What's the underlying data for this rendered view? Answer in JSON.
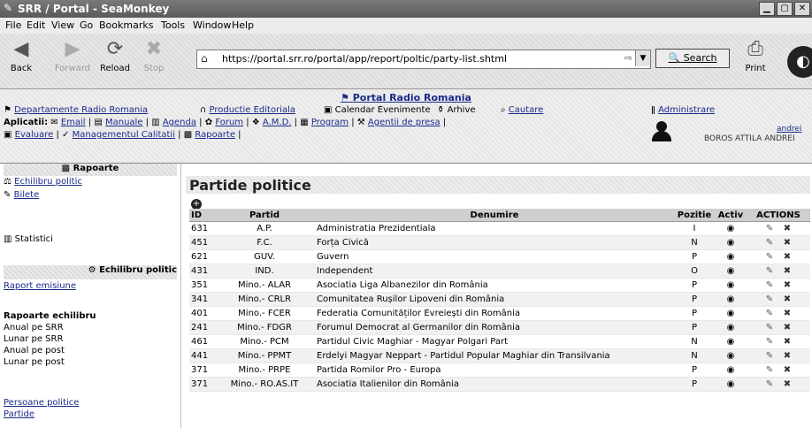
{
  "window": {
    "title": "SRR / Portal - SeaMonkey"
  },
  "menu": [
    "File",
    "Edit",
    "View",
    "Go",
    "Bookmarks",
    "Tools",
    "Window",
    "Help"
  ],
  "toolbar": {
    "back": "Back",
    "forward": "Forward",
    "reload": "Reload",
    "stop": "Stop",
    "url": "https://portal.srr.ro/portal/app/report/poltic/party-list.shtml",
    "search": "Search",
    "print": "Print"
  },
  "header": {
    "portal_title": "Portal Radio Romania",
    "nav1": [
      "Departamente Radio Romania",
      "Productie Editoriala",
      "Calendar Evenimente",
      "Arhive",
      "Cautare"
    ],
    "aplicatii_label": "Aplicatii:",
    "nav2": [
      "Email",
      "Manuale",
      "Agenda",
      "Forum",
      "A.M.D.",
      "Program",
      "Agentii de presa"
    ],
    "nav3": [
      "Evaluare",
      "Managementul Calitatii",
      "Rapoarte"
    ],
    "admin": "Administrare",
    "user_id": "andrei",
    "user_name": "BOROS ATTILA ANDREI"
  },
  "sidebar": {
    "head": "Rapoarte",
    "top": [
      "Echilibru politic",
      "Bilete"
    ],
    "statistici": "Statistici",
    "section": "Echilibru politic",
    "raport_emisiune": "Raport emisiune",
    "rapoarte_head": "Rapoarte echilibru",
    "rapoarte": [
      "Anual pe SRR",
      "Lunar pe SRR",
      "Anual pe post",
      "Lunar pe post"
    ],
    "persoane": "Persoane politice",
    "partide": "Partide"
  },
  "main": {
    "title": "Partide politice",
    "columns": [
      "ID",
      "Partid",
      "Denumire",
      "Pozitie",
      "Activ",
      "ACTIONS"
    ],
    "rows": [
      {
        "id": "631",
        "partid": "A.P.",
        "denumire": "Administratia Prezidentiala",
        "pozitie": "I"
      },
      {
        "id": "451",
        "partid": "F.C.",
        "denumire": "Forța Civică",
        "pozitie": "N"
      },
      {
        "id": "621",
        "partid": "GUV.",
        "denumire": "Guvern",
        "pozitie": "P"
      },
      {
        "id": "431",
        "partid": "IND.",
        "denumire": "Independent",
        "pozitie": "O"
      },
      {
        "id": "351",
        "partid": "Mino.- ALAR",
        "denumire": "Asociatia Liga Albanezilor din România",
        "pozitie": "P"
      },
      {
        "id": "341",
        "partid": "Mino.- CRLR",
        "denumire": "Comunitatea Rușilor Lipoveni din România",
        "pozitie": "P"
      },
      {
        "id": "401",
        "partid": "Mino.- FCER",
        "denumire": "Federatia Comunităților Evreiești din România",
        "pozitie": "P"
      },
      {
        "id": "241",
        "partid": "Mino.- FDGR",
        "denumire": "Forumul Democrat al Germanilor din România",
        "pozitie": "P"
      },
      {
        "id": "461",
        "partid": "Mino.- PCM",
        "denumire": "Partidul Civic Maghiar - Magyar Polgari Part",
        "pozitie": "N"
      },
      {
        "id": "441",
        "partid": "Mino.- PPMT",
        "denumire": "Erdelyi Magyar Neppart - Partidul Popular Maghiar din Transilvania",
        "pozitie": "N"
      },
      {
        "id": "371",
        "partid": "Mino.- PRPE",
        "denumire": "Partida Romilor Pro - Europa",
        "pozitie": "P"
      },
      {
        "id": "371",
        "partid": "Mino.- RO.AS.IT",
        "denumire": "Asociatia Italienilor din România",
        "pozitie": "P"
      }
    ]
  }
}
